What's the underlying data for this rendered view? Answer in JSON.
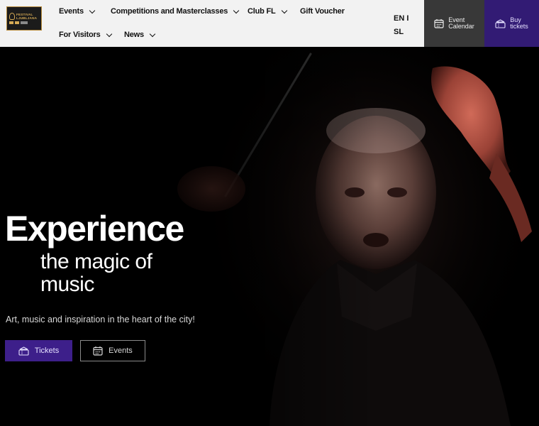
{
  "logo": {
    "line1": "FESTIVAL",
    "line2": "LJUBLJANA"
  },
  "nav": {
    "events": "Events",
    "competitions": "Competitions and Masterclasses",
    "club": "Club FL",
    "gift": "Gift Voucher",
    "visitors": "For Visitors",
    "news": "News"
  },
  "lang": {
    "en": "EN",
    "sep": "I",
    "sl": "SL"
  },
  "header_buttons": {
    "calendar_line1": "Event",
    "calendar_line2": "Calendar",
    "buy_line1": "Buy",
    "buy_line2": "tickets"
  },
  "hero": {
    "title": "Experience",
    "subtitle": "the magic of music",
    "tagline": "Art, music and inspiration in the heart of the city!",
    "tickets_label": "Tickets",
    "events_label": "Events"
  },
  "colors": {
    "accent_purple": "#321b74",
    "button_purple": "#3d1f8a",
    "header_bg": "#f2f2f2",
    "calendar_bg": "#383838"
  }
}
